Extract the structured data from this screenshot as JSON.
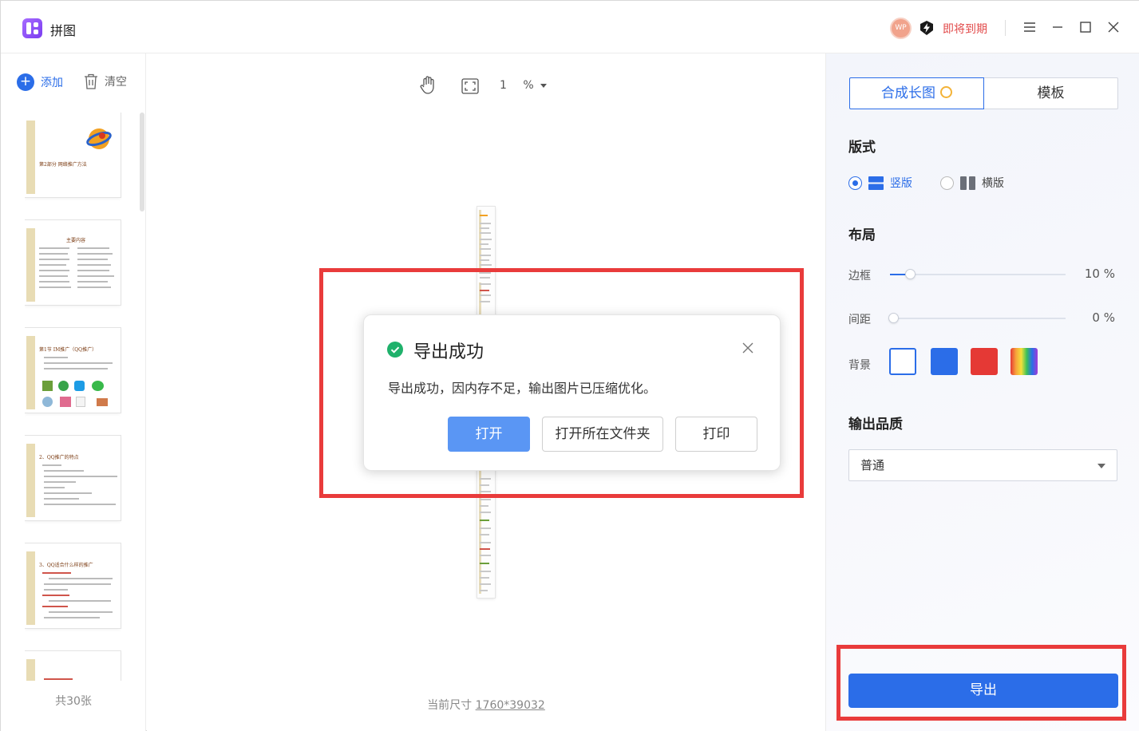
{
  "app": {
    "title": "拼图",
    "avatar_text": "WP",
    "vip_status": "即将到期"
  },
  "sidebar": {
    "add_label": "添加",
    "clear_label": "清空",
    "count_label": "共30张",
    "thumbnails": [
      {
        "title": "第2部分 网络推广方法"
      },
      {
        "title": "主要内容"
      },
      {
        "title": "第1节 IM推广（QQ推广）"
      },
      {
        "title": "2、QQ推广的特点"
      },
      {
        "title": "3、QQ适合什么样的推广"
      }
    ]
  },
  "canvas": {
    "zoom_value": "1 %",
    "size_label": "当前尺寸",
    "size_value": "1760*39032"
  },
  "dialog": {
    "title": "导出成功",
    "message": "导出成功，因内存不足，输出图片已压缩优化。",
    "open_label": "打开",
    "open_folder_label": "打开所在文件夹",
    "print_label": "打印"
  },
  "panel": {
    "tabs": [
      {
        "label": "合成长图"
      },
      {
        "label": "模板"
      }
    ],
    "layout_style_heading": "版式",
    "vertical_label": "竖版",
    "horizontal_label": "横版",
    "layout_heading": "布局",
    "border_label": "边框",
    "border_value": "10 %",
    "spacing_label": "间距",
    "spacing_value": "0 %",
    "background_label": "背景",
    "background_colors": [
      "#ffffff",
      "#2b6de8",
      "#e53935",
      "rainbow"
    ],
    "quality_heading": "输出品质",
    "quality_value": "普通",
    "export_label": "导出"
  },
  "colors": {
    "accent": "#2b6de8",
    "highlight": "#e93b3b",
    "success": "#1fb16b",
    "vip": "#e24b4b"
  }
}
